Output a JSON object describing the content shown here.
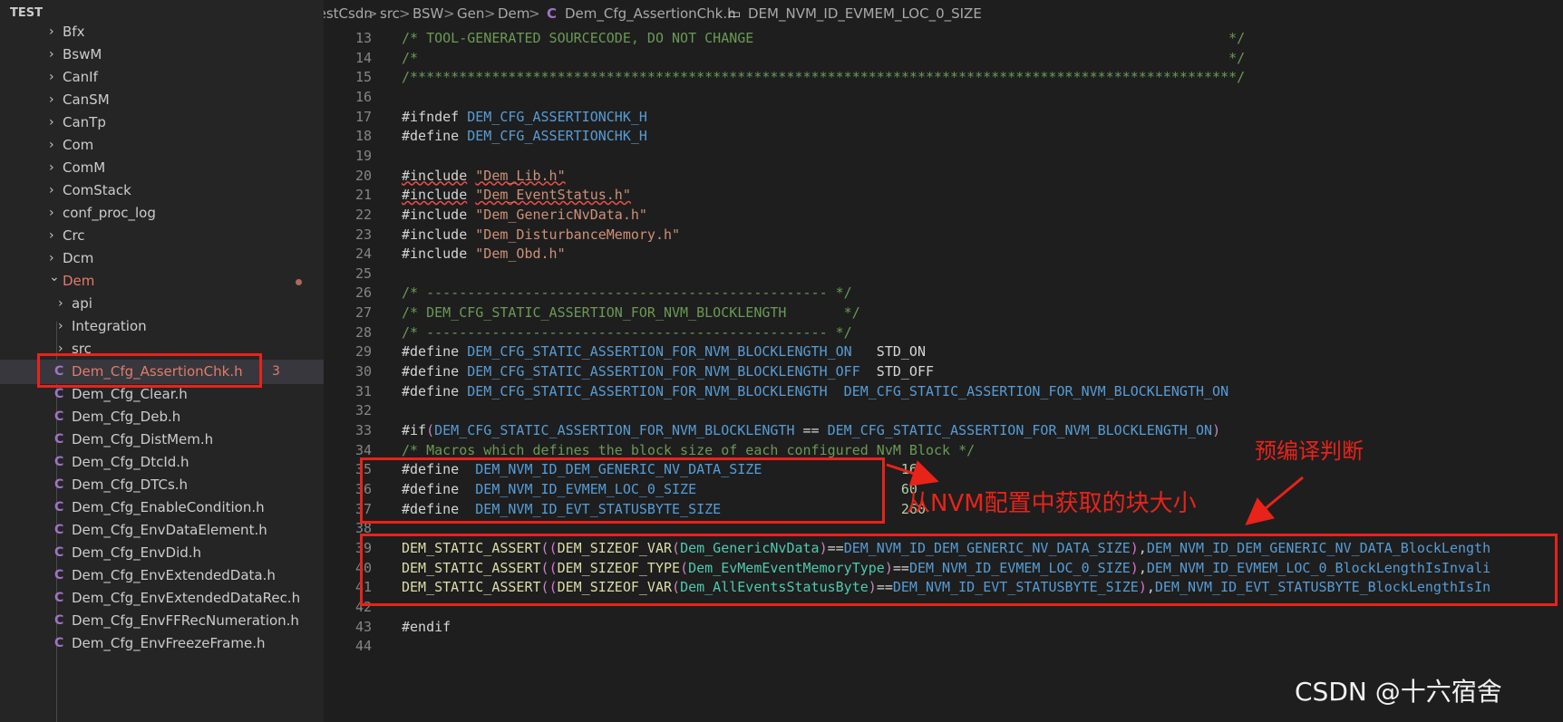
{
  "sidebar": {
    "header": "TEST",
    "items": [
      {
        "label": "Bfx",
        "kind": "folder"
      },
      {
        "label": "BswM",
        "kind": "folder"
      },
      {
        "label": "CanIf",
        "kind": "folder"
      },
      {
        "label": "CanSM",
        "kind": "folder"
      },
      {
        "label": "CanTp",
        "kind": "folder"
      },
      {
        "label": "Com",
        "kind": "folder"
      },
      {
        "label": "ComM",
        "kind": "folder"
      },
      {
        "label": "ComStack",
        "kind": "folder"
      },
      {
        "label": "conf_proc_log",
        "kind": "folder"
      },
      {
        "label": "Crc",
        "kind": "folder"
      },
      {
        "label": "Dcm",
        "kind": "folder"
      },
      {
        "label": "Dem",
        "kind": "folder-open"
      },
      {
        "label": "api",
        "kind": "subfolder"
      },
      {
        "label": "Integration",
        "kind": "subfolder"
      },
      {
        "label": "src",
        "kind": "subfolder"
      },
      {
        "label": "Dem_Cfg_AssertionChk.h",
        "kind": "file-selected",
        "badge": "3"
      },
      {
        "label": "Dem_Cfg_Clear.h",
        "kind": "file"
      },
      {
        "label": "Dem_Cfg_Deb.h",
        "kind": "file"
      },
      {
        "label": "Dem_Cfg_DistMem.h",
        "kind": "file"
      },
      {
        "label": "Dem_Cfg_DtcId.h",
        "kind": "file"
      },
      {
        "label": "Dem_Cfg_DTCs.h",
        "kind": "file"
      },
      {
        "label": "Dem_Cfg_EnableCondition.h",
        "kind": "file"
      },
      {
        "label": "Dem_Cfg_EnvDataElement.h",
        "kind": "file"
      },
      {
        "label": "Dem_Cfg_EnvDid.h",
        "kind": "file"
      },
      {
        "label": "Dem_Cfg_EnvExtendedData.h",
        "kind": "file"
      },
      {
        "label": "Dem_Cfg_EnvExtendedDataRec.h",
        "kind": "file"
      },
      {
        "label": "Dem_Cfg_EnvFFRecNumeration.h",
        "kind": "file"
      },
      {
        "label": "Dem_Cfg_EnvFreezeFrame.h",
        "kind": "file"
      }
    ],
    "file_icon": "C"
  },
  "breadcrumb": {
    "parts": [
      "TestCsdn",
      "src",
      "BSW",
      "Gen",
      "Dem",
      "Dem_Cfg_AssertionChk.h",
      "DEM_NVM_ID_EVMEM_LOC_0_SIZE"
    ],
    "separator": ">"
  },
  "code": [
    {
      "n": "13",
      "t": [
        [
          "c",
          "/* TOOL-GENERATED SOURCECODE, DO NOT CHANGE                                                          */"
        ]
      ]
    },
    {
      "n": "14",
      "t": [
        [
          "c",
          "/*                                                                                                   */"
        ]
      ]
    },
    {
      "n": "15",
      "t": [
        [
          "c",
          "/*****************************************************************************************************/"
        ]
      ]
    },
    {
      "n": "16",
      "t": []
    },
    {
      "n": "17",
      "t": [
        [
          "p",
          "#ifndef "
        ],
        [
          "m",
          "DEM_CFG_ASSERTIONCHK_H"
        ]
      ]
    },
    {
      "n": "18",
      "t": [
        [
          "p",
          "#define "
        ],
        [
          "m",
          "DEM_CFG_ASSERTIONCHK_H"
        ]
      ]
    },
    {
      "n": "19",
      "t": []
    },
    {
      "n": "20",
      "t": [
        [
          "sq",
          "#include"
        ],
        [
          "p",
          " "
        ],
        [
          "sqs",
          "\"Dem_Lib.h\""
        ]
      ]
    },
    {
      "n": "21",
      "t": [
        [
          "sq",
          "#include"
        ],
        [
          "p",
          " "
        ],
        [
          "sqs",
          "\"Dem_EventStatus.h\""
        ]
      ]
    },
    {
      "n": "22",
      "t": [
        [
          "p",
          "#include "
        ],
        [
          "s",
          "\"Dem_GenericNvData.h\""
        ]
      ]
    },
    {
      "n": "23",
      "t": [
        [
          "p",
          "#include "
        ],
        [
          "s",
          "\"Dem_DisturbanceMemory.h\""
        ]
      ]
    },
    {
      "n": "24",
      "t": [
        [
          "p",
          "#include "
        ],
        [
          "s",
          "\"Dem_Obd.h\""
        ]
      ]
    },
    {
      "n": "25",
      "t": []
    },
    {
      "n": "26",
      "t": [
        [
          "c",
          "/* ------------------------------------------------- */"
        ]
      ]
    },
    {
      "n": "27",
      "t": [
        [
          "c",
          "/* DEM_CFG_STATIC_ASSERTION_FOR_NVM_BLOCKLENGTH       */"
        ]
      ]
    },
    {
      "n": "28",
      "t": [
        [
          "c",
          "/* ------------------------------------------------- */"
        ]
      ]
    },
    {
      "n": "29",
      "t": [
        [
          "p",
          "#define "
        ],
        [
          "m",
          "DEM_CFG_STATIC_ASSERTION_FOR_NVM_BLOCKLENGTH_ON"
        ],
        [
          "p",
          "   STD_ON"
        ]
      ]
    },
    {
      "n": "30",
      "t": [
        [
          "p",
          "#define "
        ],
        [
          "m",
          "DEM_CFG_STATIC_ASSERTION_FOR_NVM_BLOCKLENGTH_OFF"
        ],
        [
          "p",
          "  STD_OFF"
        ]
      ]
    },
    {
      "n": "31",
      "t": [
        [
          "p",
          "#define "
        ],
        [
          "m",
          "DEM_CFG_STATIC_ASSERTION_FOR_NVM_BLOCKLENGTH"
        ],
        [
          "p",
          "  "
        ],
        [
          "m",
          "DEM_CFG_STATIC_ASSERTION_FOR_NVM_BLOCKLENGTH_ON"
        ]
      ]
    },
    {
      "n": "32",
      "t": []
    },
    {
      "n": "33",
      "t": [
        [
          "p",
          "#if"
        ],
        [
          "f",
          "("
        ],
        [
          "m",
          "DEM_CFG_STATIC_ASSERTION_FOR_NVM_BLOCKLENGTH"
        ],
        [
          "p",
          " == "
        ],
        [
          "m",
          "DEM_CFG_STATIC_ASSERTION_FOR_NVM_BLOCKLENGTH_ON"
        ],
        [
          "f",
          ")"
        ]
      ]
    },
    {
      "n": "34",
      "t": [
        [
          "c",
          "/* Macros which defines the block size of each configured NvM Block */"
        ]
      ]
    },
    {
      "n": "35",
      "t": [
        [
          "p",
          "#define  "
        ],
        [
          "m",
          "DEM_NVM_ID_DEM_GENERIC_NV_DATA_SIZE"
        ],
        [
          "p",
          "                 "
        ],
        [
          "num",
          "16"
        ]
      ]
    },
    {
      "n": "36",
      "t": [
        [
          "p",
          "#define  "
        ],
        [
          "m",
          "DEM_NVM_ID_EVMEM_LOC_0_SIZE"
        ],
        [
          "p",
          "                         "
        ],
        [
          "num",
          "60"
        ]
      ]
    },
    {
      "n": "37",
      "t": [
        [
          "p",
          "#define  "
        ],
        [
          "m",
          "DEM_NVM_ID_EVT_STATUSBYTE_SIZE"
        ],
        [
          "p",
          "                      "
        ],
        [
          "num",
          "260"
        ]
      ]
    },
    {
      "n": "38",
      "t": []
    },
    {
      "n": "39",
      "t": [
        [
          "fn",
          "DEM_STATIC_ASSERT"
        ],
        [
          "f",
          "("
        ],
        [
          "pa",
          "("
        ],
        [
          "fn",
          "DEM_SIZEOF_VAR"
        ],
        [
          "f",
          "("
        ],
        [
          "ty",
          "Dem_GenericNvData"
        ],
        [
          "f",
          ")"
        ],
        [
          "p",
          "=="
        ],
        [
          "m",
          "DEM_NVM_ID_DEM_GENERIC_NV_DATA_SIZE"
        ],
        [
          "pa",
          ")"
        ],
        [
          "p",
          ","
        ],
        [
          "m",
          "DEM_NVM_ID_DEM_GENERIC_NV_DATA_BlockLength"
        ]
      ]
    },
    {
      "n": "40",
      "t": [
        [
          "fn",
          "DEM_STATIC_ASSERT"
        ],
        [
          "f",
          "("
        ],
        [
          "pa",
          "("
        ],
        [
          "fn",
          "DEM_SIZEOF_TYPE"
        ],
        [
          "f",
          "("
        ],
        [
          "ty",
          "Dem_EvMemEventMemoryType"
        ],
        [
          "f",
          ")"
        ],
        [
          "p",
          "=="
        ],
        [
          "m",
          "DEM_NVM_ID_EVMEM_LOC_0_SIZE"
        ],
        [
          "pa",
          ")"
        ],
        [
          "p",
          ","
        ],
        [
          "m",
          "DEM_NVM_ID_EVMEM_LOC_0_BlockLengthIsInvali"
        ]
      ]
    },
    {
      "n": "41",
      "t": [
        [
          "fn",
          "DEM_STATIC_ASSERT"
        ],
        [
          "f",
          "("
        ],
        [
          "pa",
          "("
        ],
        [
          "fn",
          "DEM_SIZEOF_VAR"
        ],
        [
          "f",
          "("
        ],
        [
          "ty",
          "Dem_AllEventsStatusByte"
        ],
        [
          "f",
          ")"
        ],
        [
          "p",
          "=="
        ],
        [
          "m",
          "DEM_NVM_ID_EVT_STATUSBYTE_SIZE"
        ],
        [
          "pa",
          ")"
        ],
        [
          "p",
          ","
        ],
        [
          "m",
          "DEM_NVM_ID_EVT_STATUSBYTE_BlockLengthIsIn"
        ]
      ]
    },
    {
      "n": "42",
      "t": []
    },
    {
      "n": "43",
      "t": [
        [
          "p",
          "#endif"
        ]
      ]
    },
    {
      "n": "44",
      "t": []
    }
  ],
  "annotations": {
    "label_nvm": "从NVM配置中获取的块大小",
    "label_precompile": "预编译判断"
  },
  "watermark": "CSDN @十六宿舍",
  "colors": {
    "annotation_red": "#e8231a",
    "comment": "#6a9955",
    "string": "#ce9178",
    "macro": "#569cd6",
    "number": "#b5cea8",
    "function": "#dcdcaa"
  }
}
